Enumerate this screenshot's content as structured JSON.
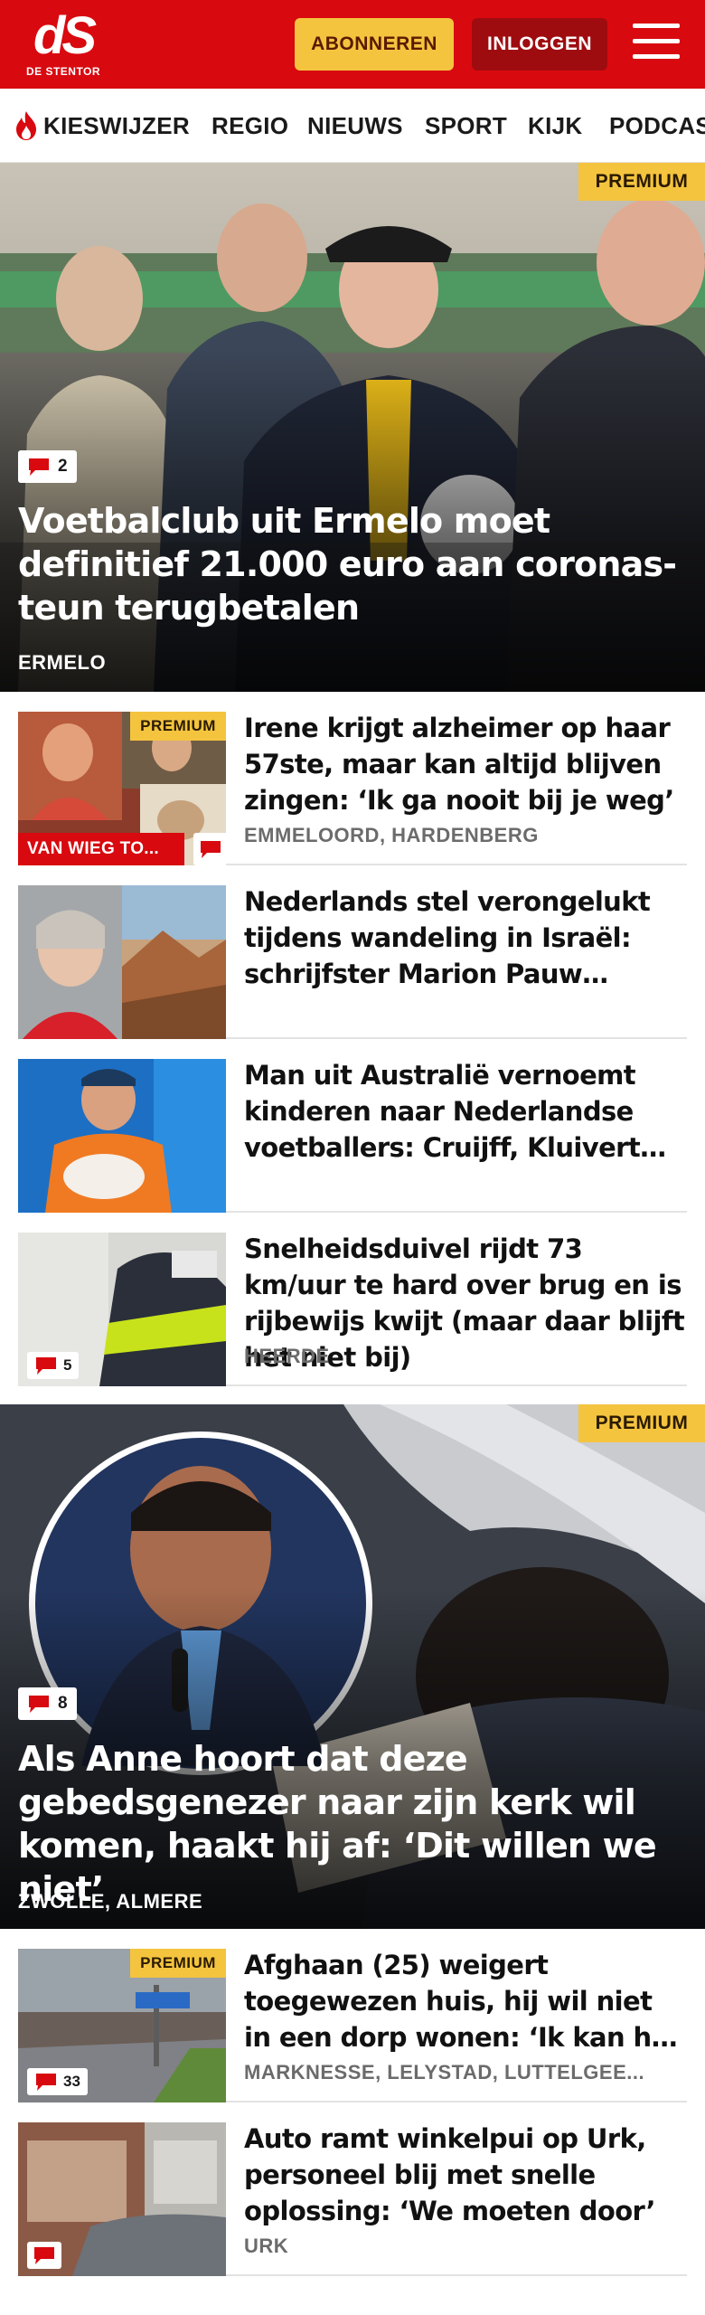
{
  "header": {
    "logo_mark": "dS",
    "logo_text": "DE STENTOR",
    "subscribe_label": "ABONNEREN",
    "login_label": "INLOGGEN",
    "brand_red": "#d8090f",
    "accent_yellow": "#f4c43f",
    "menu_icon": "hamburger-icon"
  },
  "nav": {
    "items": [
      {
        "label": "KIESWIJZER",
        "icon": "flame-icon"
      },
      {
        "label": "REGIO"
      },
      {
        "label": "NIEUWS"
      },
      {
        "label": "SPORT"
      },
      {
        "label": "KIJK"
      },
      {
        "label": "PODCAS"
      }
    ]
  },
  "articles": {
    "hero1": {
      "premium_label": "PREMIUM",
      "comments": "2",
      "title": "Voetbalclub uit Ermelo moet definitief 21.000 euro aan coronas­teun terugbetalen",
      "location": "ERMELO"
    },
    "card1": {
      "premium_label": "PREMIUM",
      "tag": "VAN WIEG TO...",
      "title": "Irene krijgt alzheimer op haar 57ste, maar kan altijd blijven zingen: ‘Ik ga nooit bij je weg’",
      "location": "EMMELOORD, HARDENBERG"
    },
    "card2": {
      "title": "Nederlands stel verongelukt tijdens wandeling in Israël: schrijfster Marion Pauw verliest..."
    },
    "card3": {
      "title": "Man uit Australië vernoemt kinderen naar Nederlandse voetballers: Cruijff, Kluivert en..."
    },
    "card4": {
      "comments": "5",
      "title": "Snelheidsduivel rijdt 73 km/uur te hard over brug en is rijbewijs kwijt (maar daar blijft het niet bij)",
      "location": "HEERDE"
    },
    "hero2": {
      "premium_label": "PREMIUM",
      "comments": "8",
      "title": "Als Anne hoort dat deze gebedsgene­zer naar zijn kerk wil komen, haakt hij af: ‘Dit willen we niet’",
      "location": "ZWOLLE, ALMERE"
    },
    "card5": {
      "premium_label": "PREMIUM",
      "comments": "33",
      "title": "Afghaan (25) weigert toegewezen huis, hij wil niet in een dorp wonen: ‘Ik kan het niet...",
      "location": "MARKNESSE, LELYSTAD, LUTTELGEE..."
    },
    "card6": {
      "title": "Auto ramt winkelpui op Urk, personeel blij met snelle oplossing: ‘We moeten door’",
      "location": "URK"
    }
  }
}
